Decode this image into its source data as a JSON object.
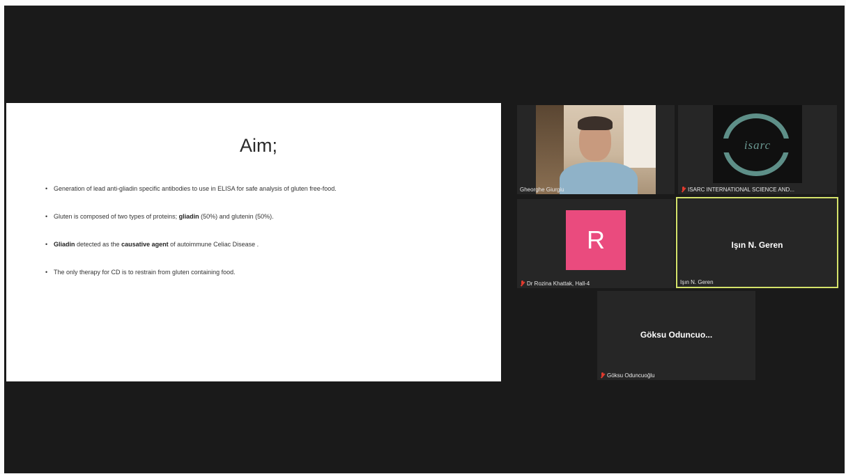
{
  "slide": {
    "title": "Aim;",
    "bullets": [
      {
        "a": "Generation of lead anti-gliadin specific antibodies to use in ELISA for safe analysis of gluten free-food.",
        "b": "",
        "c": "",
        "d": "",
        "e": ""
      },
      {
        "a": "Gluten is composed of two types of proteins; ",
        "b": "gliadin",
        "c": " (50%) and glutenin (50%).",
        "d": "",
        "e": ""
      },
      {
        "a": "",
        "b": "Gliadin",
        "c": " detected as the ",
        "d": "causative agent",
        "e": " of autoimmune Celiac Disease ."
      },
      {
        "a": "The only therapy for CD is to restrain from gluten containing food.",
        "b": "",
        "c": "",
        "d": "",
        "e": ""
      }
    ],
    "bullet_char": "•"
  },
  "participants": [
    {
      "name": "Gheorghe Giurgiu",
      "muted": false,
      "video": "webcam"
    },
    {
      "name": "ISARC INTERNATIONAL SCIENCE AND...",
      "muted": true,
      "video": "logo",
      "logo_text": "isarc"
    },
    {
      "name": "Dr Rozina Khattak, Hall-4",
      "muted": true,
      "avatar_letter": "R"
    },
    {
      "name": "Işın N. Geren",
      "display_name": "Işın N. Geren",
      "muted": false,
      "active_speaker": true
    },
    {
      "name": "Göksu Oduncuoğlu",
      "display_name": "Göksu  Oduncuo...",
      "muted": true
    }
  ],
  "colors": {
    "background": "#1a1a1a",
    "tile": "#262626",
    "active_border": "#d4e26a",
    "avatar": "#ea4b7e",
    "muted": "#e03a2e"
  }
}
